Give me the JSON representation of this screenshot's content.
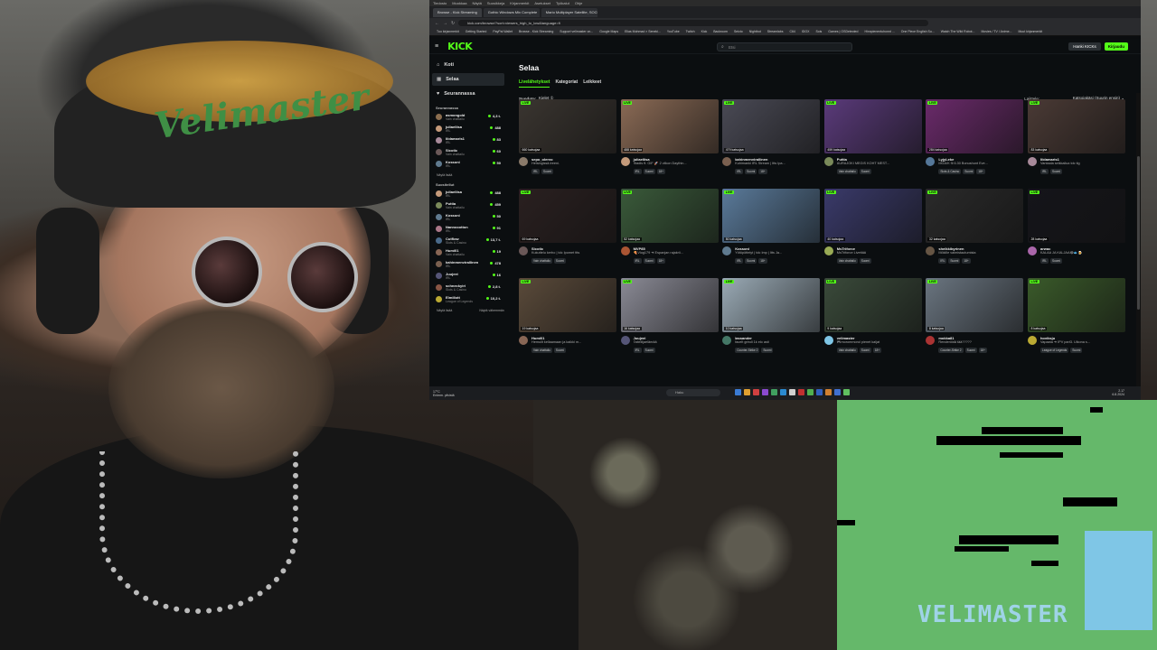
{
  "webcam": {
    "cap_text": "Velimaster"
  },
  "retro": {
    "logo": "VELIMASTER"
  },
  "browser": {
    "menubar": [
      "Tiedosto",
      "Muokkaa",
      "Näytä",
      "Suosikkeja",
      "Kirjanmerkit",
      "Asetukset",
      "Työkalut",
      "Ohje"
    ],
    "tabs": [
      {
        "label": "Browse - Kick Streaming",
        "active": true
      },
      {
        "label": "Gothic Windows Mix Complete",
        "active": false
      },
      {
        "label": "Mario Multiplayer Satellite, SOCI",
        "active": false
      }
    ],
    "url": "kick.com/browse/?sort=viewers_high_to_low&language=fi",
    "bookmarks": [
      "Tuo kirjanmerkit",
      "Getting Started",
      "PayPal Wallet",
      "Browse - Kick Streaming",
      "Support velimaster on...",
      "Google Maps",
      "Elias Mohmad × Seneki...",
      "YouTube",
      "Twitch",
      "Kick",
      "Backroom",
      "Seicto",
      "Nightbot",
      "Streamlabs",
      "C64",
      "IDOX",
      "Sois",
      "Games | OSDetected",
      "Hinnpienentuhonnt ...",
      "One Piece English Su...",
      "Watch The Wild Robot...",
      "Movies / TV / Anime...",
      "Muut kirjanmerkit"
    ]
  },
  "kick": {
    "search_placeholder": "Etsi",
    "login_label": "Kirjaudu",
    "user_label": "Hanki KICKs",
    "nav": [
      {
        "label": "Koti",
        "icon": "home-icon",
        "active": false
      },
      {
        "label": "Selaa",
        "icon": "browse-icon",
        "active": true
      },
      {
        "label": "Seurannassa",
        "icon": "heart-icon",
        "active": false
      }
    ],
    "following_heading": "Seurannassa",
    "following": [
      {
        "name": "asmongold",
        "cat": "Vain chattailu",
        "viewers": "4,3 t.",
        "color": "#8a6d4f"
      },
      {
        "name": "juliaeliisa",
        "cat": "IRL",
        "viewers": "488",
        "color": "#c49a7a"
      },
      {
        "name": "liidamaris1",
        "cat": "IRL",
        "viewers": "83",
        "color": "#a88a9a"
      },
      {
        "name": "Sicotic",
        "cat": "Vain chattailu",
        "viewers": "60",
        "color": "#6a5858"
      },
      {
        "name": "Kossoni",
        "cat": "IRL",
        "viewers": "50",
        "color": "#5f7a8f"
      }
    ],
    "show_more_1": "Näytä lisää",
    "recommended_heading": "Suositellut",
    "recommended": [
      {
        "name": "juliaeliisa",
        "cat": "IRL",
        "viewers": "488",
        "color": "#c49a7a"
      },
      {
        "name": "Puttia",
        "cat": "Vain chattailu",
        "viewers": "459",
        "color": "#7a8a5a"
      },
      {
        "name": "Kossoni",
        "cat": "IRL",
        "viewers": "50",
        "color": "#5f7a8f"
      },
      {
        "name": "Nannocotton",
        "cat": "IRL",
        "viewers": "91",
        "color": "#aa7788"
      },
      {
        "name": "Cutflow",
        "cat": "Slots & Casino",
        "viewers": "13,7 t.",
        "color": "#4a6a8a"
      },
      {
        "name": "Humi01",
        "cat": "Vain chattailu",
        "viewers": "19",
        "color": "#886655"
      },
      {
        "name": "kahinmenvirallinen",
        "cat": "IRL",
        "viewers": "478",
        "color": "#7a6050"
      },
      {
        "name": "Juujeei",
        "cat": "IRL",
        "viewers": "16",
        "color": "#555577"
      },
      {
        "name": "schneckyiri",
        "cat": "Slots & Casino",
        "viewers": "2,8 t.",
        "color": "#885544"
      },
      {
        "name": "Elmillott",
        "cat": "League of Legends",
        "viewers": "10,2 t.",
        "color": "#bbaa33"
      }
    ],
    "show_more_2": "Näytä lisää",
    "show_less_2": "Näytä vähemmän",
    "page_title": "Selaa",
    "subtabs": [
      {
        "label": "Livelähetykset",
        "active": true
      },
      {
        "label": "Kategoriat",
        "active": false
      },
      {
        "label": "Leikkeet",
        "active": false
      }
    ],
    "filter_label": "Suodata:",
    "filter_value": "Kielet ①",
    "sort_label": "Lajittele:",
    "sort_value": "Katsojakäsi (Suurin ensin) ⌄",
    "live_label": "LIVE",
    "cards": [
      {
        "viewers": "660 katsojaa",
        "name": "sepo_olervo",
        "title": "Helsingissä.treeni.",
        "tags": [
          "IRL",
          "Suomi"
        ],
        "thumb": "#3a3530",
        "av": "#8a7a6a"
      },
      {
        "viewers": "488 katsojaa",
        "name": "juliaeliisa",
        "title": "Stadis ft. GIF 🚀 2 viikon Daythin...",
        "tags": [
          "IRL",
          "Suomi",
          "18+"
        ],
        "thumb": "#8a6a55",
        "av": "#c49a7a"
      },
      {
        "viewers": "479 katsojaa",
        "name": "kahinmenvirallinen",
        "title": "Kuhimanki IRL Stream | Itts Ipa...",
        "tags": [
          "IRL",
          "Suomi",
          "18+"
        ],
        "thumb": "#4a4a55",
        "av": "#7a6050"
      },
      {
        "viewers": "459 katsojaa",
        "name": "Puttia",
        "title": "AURAJOKI MEGIS KOHT MEST...",
        "tags": [
          "Vain chattailu",
          "Suomi"
        ],
        "thumb": "#5a3a7a",
        "av": "#7a8a5a"
      },
      {
        "viewers": "284 katsojaa",
        "name": "LyjyLeke",
        "title": "MGA/K fil 6.30 Bonushunt Eve...",
        "tags": [
          "Slots & Casino",
          "Suomi",
          "18+"
        ],
        "thumb": "#6a2a6a",
        "av": "#557799"
      },
      {
        "viewers": "83 katsojaa",
        "name": "liidamaris1",
        "title": "Vantaala seikkailua tdc tig",
        "tags": [
          "IRL",
          "Suomi"
        ],
        "thumb": "#4a3a35",
        "av": "#a88a9a"
      },
      {
        "viewers": "69 katsojaa",
        "name": "Sicotic",
        "title": "Kukuttelu kerho | tdc Ipomet ttts",
        "tags": [
          "Vain chattailu",
          "Suomi"
        ],
        "thumb": "#2a2020",
        "av": "#6a5858"
      },
      {
        "viewers": "52 katsojaa",
        "name": "MVP85",
        "title": "🍕Vlog179 ➜ Espanjan rajakrii...",
        "tags": [
          "IRL",
          "Suomi",
          "18+"
        ],
        "thumb": "#3a5a3a",
        "av": "#aa5533"
      },
      {
        "viewers": "50 katsojaa",
        "name": "Kossoni",
        "title": "Yötöpöttelyt | tdc Imp | Itts Ja...",
        "tags": [
          "IRL",
          "Suomi",
          "18+"
        ],
        "thumb": "#5a7a9a",
        "av": "#5f7a8f"
      },
      {
        "viewers": "40 katsojaa",
        "name": "MsTriforce",
        "title": "MsTriforce Livettää",
        "tags": [
          "Vain chattailu",
          "Suomi"
        ],
        "thumb": "#3a3a6a",
        "av": "#99aa55"
      },
      {
        "viewers": "32 katsojaa",
        "name": "sheikkibyrinen",
        "title": "Mökille valmistautumista",
        "tags": [
          "IRL",
          "Suomi",
          "18+"
        ],
        "thumb": "#2a2a2a",
        "av": "#665544"
      },
      {
        "viewers": "28 katsojaa",
        "name": "arwac",
        "title": "KALAA JA KALJAA😂🐟🍺",
        "tags": [
          "IRL",
          "Suomi"
        ],
        "thumb": "#15151a",
        "av": "#aa66aa"
      },
      {
        "viewers": "19 katsojaa",
        "name": "Humi01",
        "title": "Hemulit kellaamaan ja kaikki m...",
        "tags": [
          "Vain chattailu",
          "Suomi"
        ],
        "thumb": "#5a4a3a",
        "av": "#886655"
      },
      {
        "viewers": "16 katsojaa",
        "name": "Juujeei",
        "title": "Taiteilijaelämää",
        "tags": [
          "IRL",
          "Suomi"
        ],
        "thumb": "#8a8a95",
        "av": "#555577"
      },
      {
        "viewers": "10 katsojaa",
        "name": "lassander",
        "title": "facelt grindi 1k elo asti",
        "tags": [
          "Counter-Strike 2",
          "Suomi"
        ],
        "thumb": "#9aaab5",
        "av": "#447766"
      },
      {
        "viewers": "9 katsojaa",
        "name": "velimaster",
        "title": "🎮morommoroi pienet kaljat",
        "tags": [
          "Vain chattailu",
          "Suomi",
          "18+"
        ],
        "thumb": "#3a4a3a",
        "av": "#7fc6e6"
      },
      {
        "viewers": "8 katsojaa",
        "name": "mokka81",
        "title": "Renderöidä tää?????",
        "tags": [
          "Counter-Strike 2",
          "Suomi",
          "18+"
        ],
        "thumb": "#6a7580",
        "av": "#aa3333"
      },
      {
        "viewers": "8 katsojaa",
        "name": "hoviksju",
        "title": "Vapaata ➜ IPV part3. Uikona s...",
        "tags": [
          "League of Legends",
          "Suomi"
        ],
        "thumb": "#3a5a2a",
        "av": "#bbaa33"
      }
    ]
  },
  "taskbar": {
    "weather_temp": "17°C",
    "weather_desc": "Enimm. pilvistä",
    "search_placeholder": "Haku",
    "time": "2.17",
    "date": "6.8.2024"
  }
}
